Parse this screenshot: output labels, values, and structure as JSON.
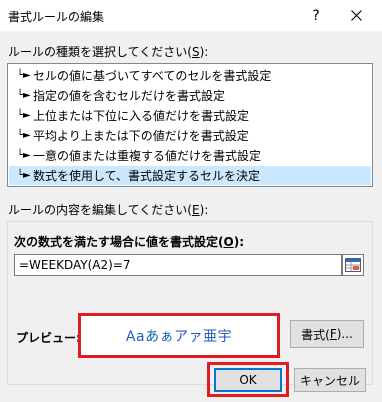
{
  "window": {
    "title": "書式ルールの編集",
    "help_glyph": "?"
  },
  "rule_type": {
    "label_prefix": "ルールの種類を選択してください(",
    "label_key": "S",
    "label_suffix": "):",
    "items": [
      {
        "label": "セルの値に基づいてすべてのセルを書式設定"
      },
      {
        "label": "指定の値を含むセルだけを書式設定"
      },
      {
        "label": "上位または下位に入る値だけを書式設定"
      },
      {
        "label": "平均より上または下の値だけを書式設定"
      },
      {
        "label": "一意の値または重複する値だけを書式設定"
      },
      {
        "label": "数式を使用して、書式設定するセルを決定"
      }
    ],
    "selected_index": 5
  },
  "rule_content": {
    "label_prefix": "ルールの内容を編集してください(",
    "label_key": "E",
    "label_suffix": "):",
    "formula_label_prefix": "次の数式を満たす場合に値を書式設定(",
    "formula_label_key": "O",
    "formula_label_suffix": "):",
    "formula_value": "=WEEKDAY(A2)=7"
  },
  "preview": {
    "label": "プレビュー:",
    "sample_text": "Aaあぁアァ亜宇",
    "sample_color": "#1e5fb4"
  },
  "buttons": {
    "format_prefix": "書式(",
    "format_key": "F",
    "format_suffix": ")...",
    "ok": "OK",
    "cancel": "キャンセル"
  },
  "colors": {
    "highlight": "#e01b24",
    "selection": "#cce8ff",
    "focus_border": "#0078d7"
  },
  "icons": {
    "help": "question-mark",
    "close": "x-mark",
    "rule_marker": "right-arrow-bar",
    "collapse": "range-collapse-icon"
  }
}
